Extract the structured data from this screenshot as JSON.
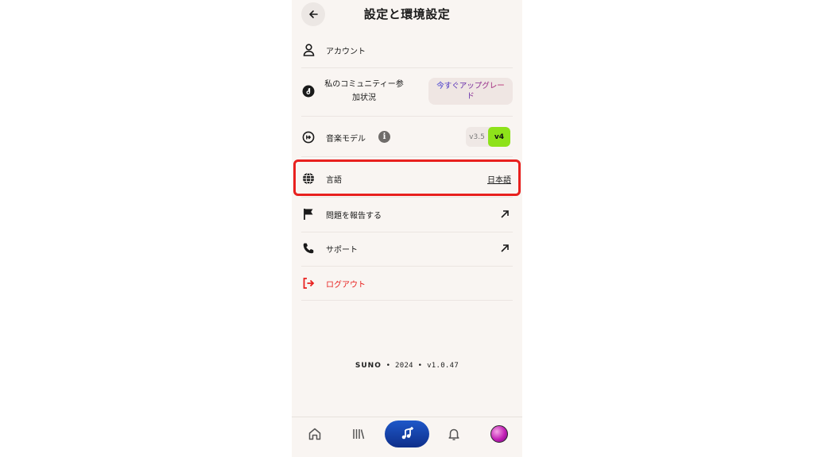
{
  "header": {
    "title": "設定と環境設定"
  },
  "rows": {
    "account": {
      "label": "アカウント"
    },
    "community": {
      "label_line1": "私のコミュニティー参",
      "label_line2": "加状況",
      "upgrade_line1": "今すぐアップグレー",
      "upgrade_line2": "ド"
    },
    "music_model": {
      "label": "音楽モデル",
      "info": "i",
      "options": [
        "v3.5",
        "v4"
      ],
      "selected": "v4"
    },
    "language": {
      "label": "言語",
      "value": "日本語"
    },
    "report": {
      "label": "問題を報告する"
    },
    "support": {
      "label": "サポート"
    },
    "logout": {
      "label": "ログアウト"
    }
  },
  "footer": {
    "brand": "SUNO",
    "year": "2024",
    "version": "v1.0.47",
    "sep": "•"
  },
  "tabbar": {
    "icons": [
      "home-icon",
      "library-icon",
      "create-music-icon",
      "bell-icon",
      "avatar"
    ]
  },
  "colors": {
    "accent_green": "#8ee21a",
    "logout_red": "#e8201e",
    "highlight_red": "#e8201e",
    "create_blue": "#1f58c9",
    "background": "#f9f5f2"
  }
}
